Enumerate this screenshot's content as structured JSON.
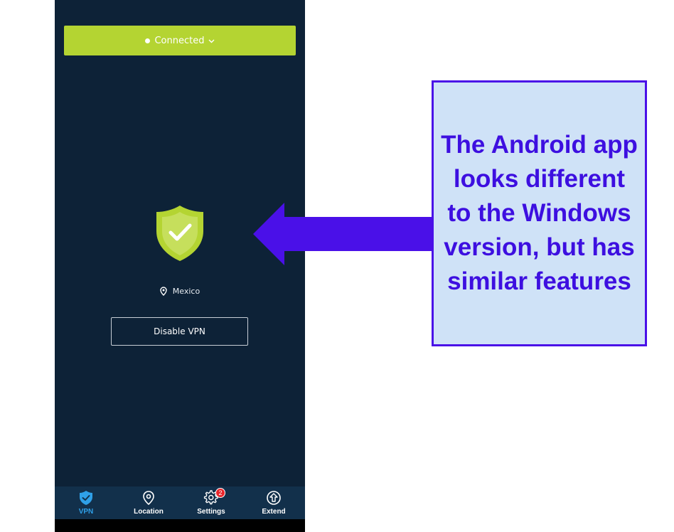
{
  "app": {
    "status_label": "Connected",
    "location_name": "Mexico",
    "disable_button_label": "Disable VPN",
    "nav": {
      "items": [
        {
          "label": "VPN",
          "icon": "shield-check-icon",
          "active": true
        },
        {
          "label": "Location",
          "icon": "location-pin-icon"
        },
        {
          "label": "Settings",
          "icon": "gear-icon",
          "badge": "2"
        },
        {
          "label": "Extend",
          "icon": "extend-arrow-icon"
        }
      ]
    }
  },
  "callout": {
    "text": "The Android app looks different to the Windows version, but has similar features"
  },
  "colors": {
    "app_background": "#0d2237",
    "accent_green": "#b4d432",
    "nav_background": "#12304b",
    "nav_active": "#2fa0e8",
    "callout_border": "#4a10e8",
    "callout_background": "#cfe2f7",
    "callout_text": "#3d0fe0",
    "badge_red": "#e8262b"
  }
}
